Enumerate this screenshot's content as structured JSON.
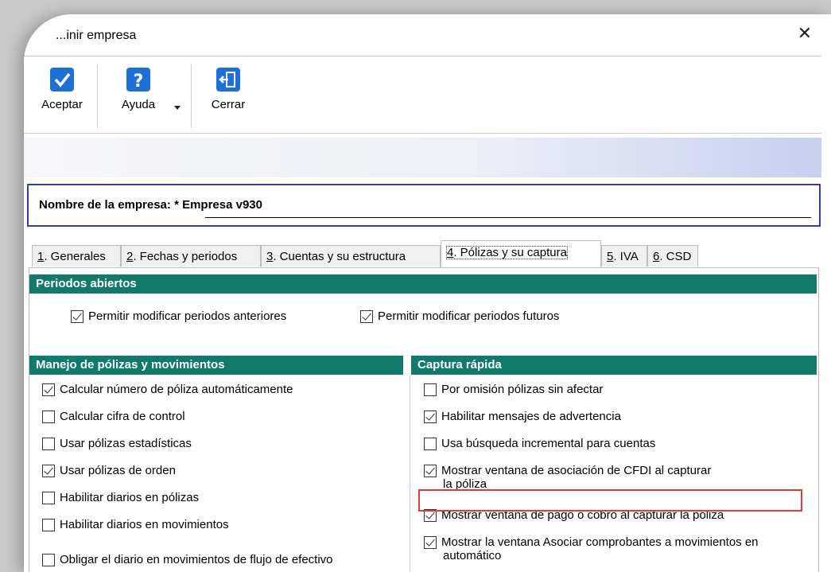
{
  "window": {
    "title": "...inir empresa",
    "close_glyph": "✕"
  },
  "toolbar": {
    "accept": {
      "label": "Aceptar",
      "icon": "check-icon",
      "color": "#1e6fd6"
    },
    "help": {
      "label": "Ayuda",
      "icon": "question-icon",
      "color": "#1e6fd6"
    },
    "close": {
      "label": "Cerrar",
      "icon": "exit-door-icon",
      "color": "#1e6fd6"
    }
  },
  "company": {
    "label": "Nombre de la empresa:",
    "value": "* Empresa v930"
  },
  "tabs": [
    {
      "num": "1",
      "label": ". Generales",
      "active": false
    },
    {
      "num": "2",
      "label": ". Fechas y periodos",
      "active": false
    },
    {
      "num": "3",
      "label": ". Cuentas y su estructura",
      "active": false
    },
    {
      "num": "4",
      "label": ". Pólizas y su captura",
      "active": true
    },
    {
      "num": "5",
      "label": ". IVA",
      "active": false
    },
    {
      "num": "6",
      "label": ". CSD",
      "active": false
    }
  ],
  "sections": {
    "periodos": "Periodos abiertos",
    "manejo": "Manejo de pólizas y movimientos",
    "captura": "Captura rápida"
  },
  "periodos": [
    {
      "label": "Permitir modificar periodos anteriores",
      "checked": true
    },
    {
      "label": "Permitir modificar periodos futuros",
      "checked": true
    }
  ],
  "manejo": [
    {
      "label": "Calcular número de póliza automáticamente",
      "checked": true
    },
    {
      "label": "Calcular cifra de control",
      "checked": false
    },
    {
      "label": "Usar pólizas estadísticas",
      "checked": false
    },
    {
      "label": "Usar pólizas de orden",
      "checked": true
    },
    {
      "label": "Habilitar diarios en pólizas",
      "checked": false
    },
    {
      "label": "Habilitar diarios en movimientos",
      "checked": false
    },
    {
      "label": "Obligar el diario en movimientos de flujo de efectivo",
      "checked": false
    }
  ],
  "captura": [
    {
      "label": "Por omisión pólizas sin afectar",
      "checked": false
    },
    {
      "label": "Habilitar mensajes de advertencia",
      "checked": true
    },
    {
      "label": "Usa búsqueda incremental para cuentas",
      "checked": false
    },
    {
      "label": "Mostrar ventana de asociación de CFDI al capturar",
      "label2": "la póliza",
      "checked": true
    },
    {
      "label": "Mostrar ventana de pago o cobro al capturar la póliza",
      "checked": true
    },
    {
      "label": "Mostrar la ventana Asociar comprobantes a movimientos en",
      "label2": "automático",
      "checked": true
    }
  ],
  "colors": {
    "section_header": "#117a6b",
    "highlight": "#e53935",
    "name_border": "#2e3fb0"
  }
}
